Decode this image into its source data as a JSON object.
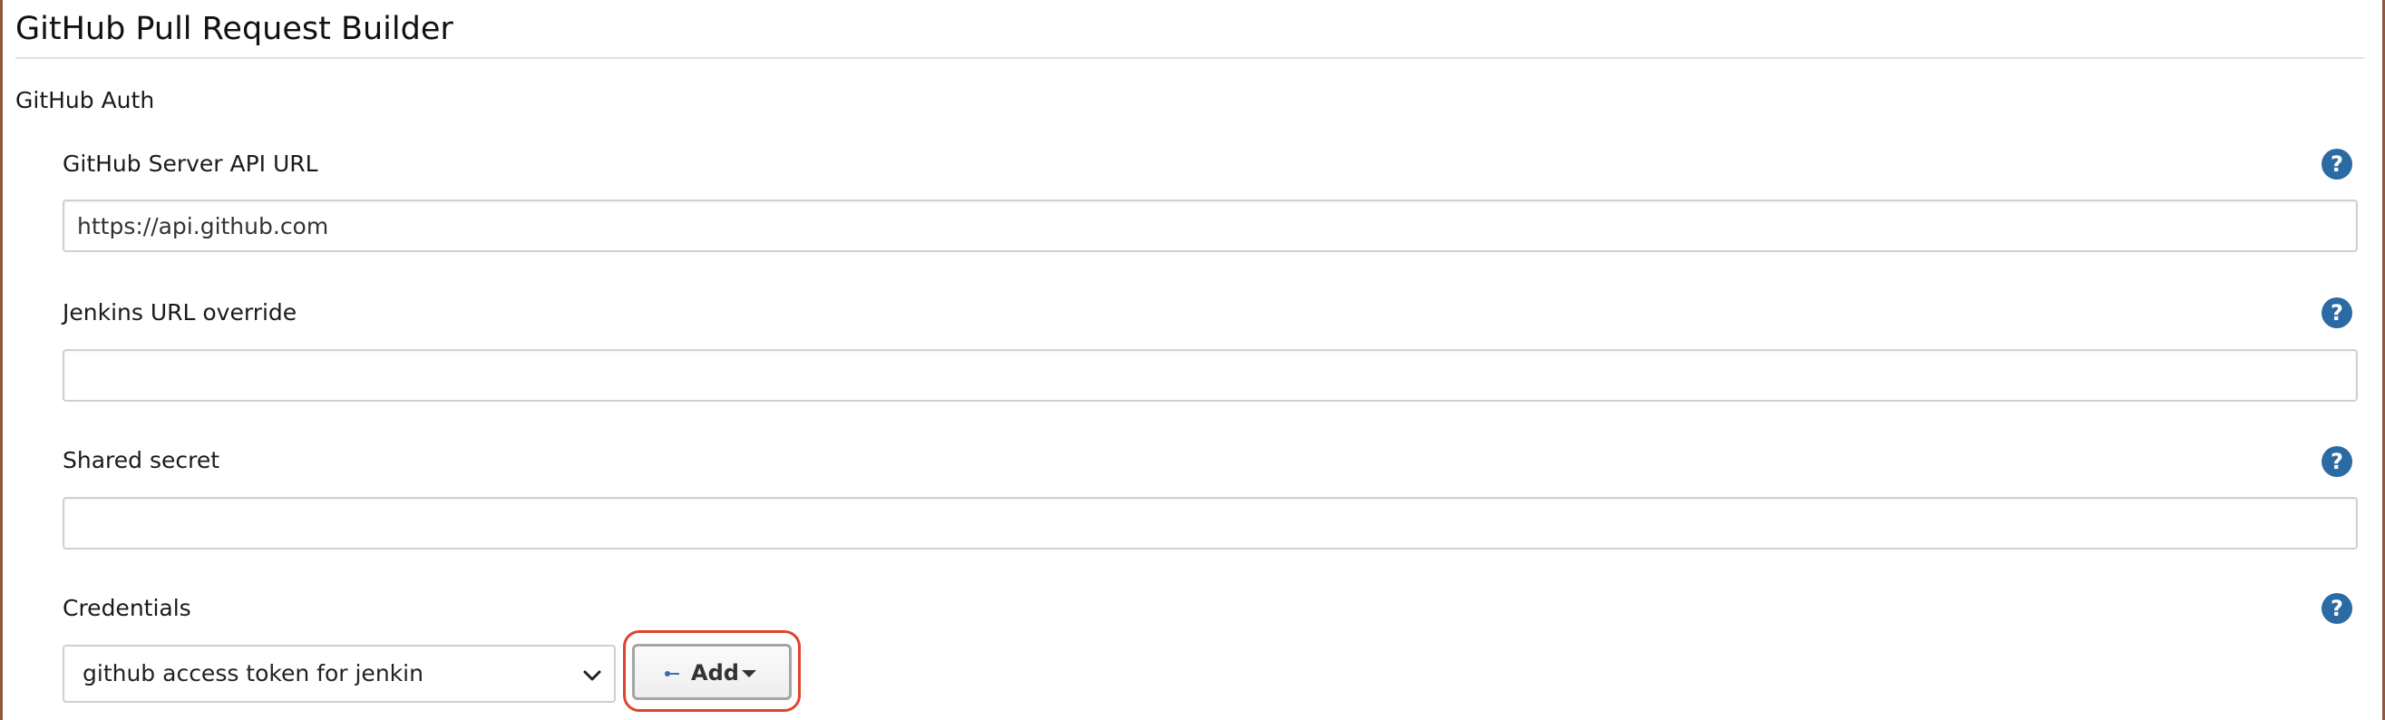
{
  "page": {
    "title": "GitHub Pull Request Builder",
    "section_label": "GitHub Auth"
  },
  "fields": [
    {
      "label": "GitHub Server API URL",
      "value": "https://api.github.com",
      "help_icon": "help-question-icon"
    },
    {
      "label": "Jenkins URL override",
      "value": "",
      "help_icon": "help-question-icon"
    },
    {
      "label": "Shared secret",
      "value": "",
      "help_icon": "help-question-icon"
    }
  ],
  "credentials": {
    "label": "Credentials",
    "selected": "github access token for jenkin",
    "help_icon": "help-question-icon",
    "add_button_label": "Add",
    "add_icon": "key-icon",
    "dropdown_icon": "chevron-down-icon"
  },
  "colors": {
    "help_icon_bg": "#2b6aa3",
    "highlight_ring": "#e0442c",
    "divider": "#e1e1e1"
  },
  "help_glyph": "?"
}
